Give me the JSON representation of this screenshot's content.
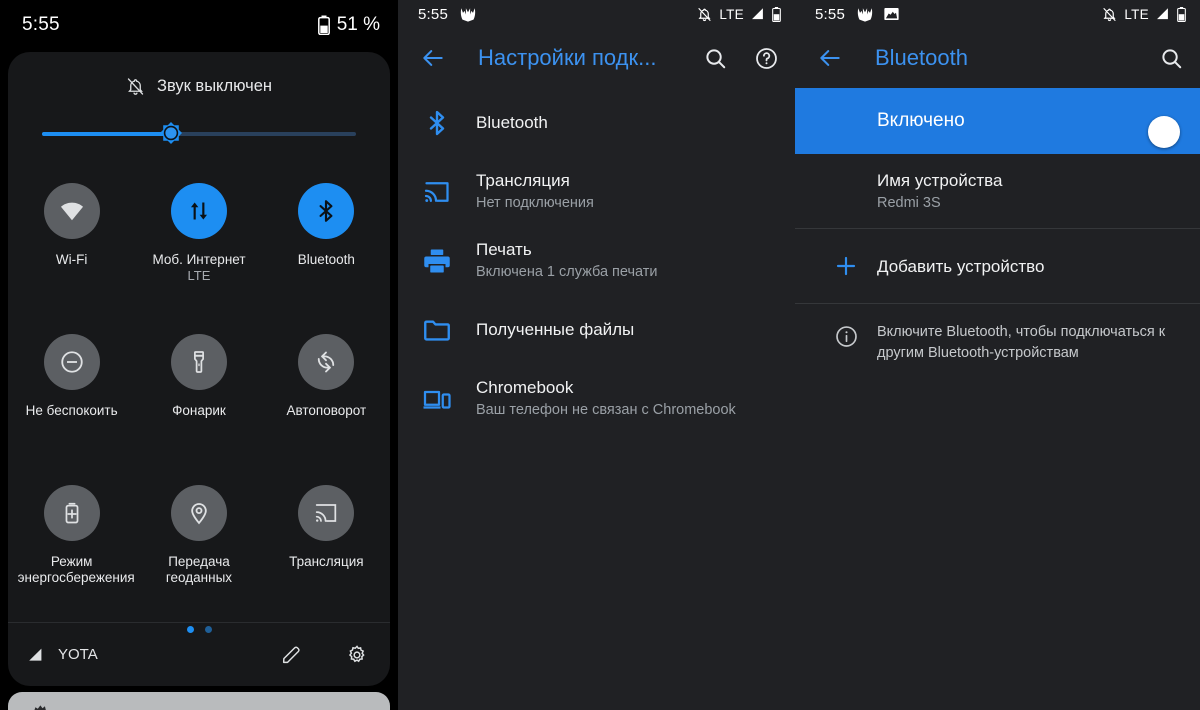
{
  "quick_settings": {
    "status_bar": {
      "clock": "5:55",
      "battery_percent": "51 %",
      "battery_icon": "battery-icon"
    },
    "sound": {
      "label": "Звук выключен",
      "icon": "bell-muted-icon"
    },
    "brightness_slider": {
      "name": "brightness-slider",
      "value_percent": 41,
      "thumb_icon": "brightness-sun-icon"
    },
    "tiles": [
      {
        "label": "Wi-Fi",
        "sub": "",
        "icon": "wifi-icon",
        "active": false
      },
      {
        "label": "Моб. Интернет",
        "sub": "LTE",
        "icon": "mobile-data-icon",
        "active": true
      },
      {
        "label": "Bluetooth",
        "sub": "",
        "icon": "bluetooth-icon",
        "active": true
      },
      {
        "label": "Не беспокоить",
        "sub": "",
        "icon": "do-not-disturb-icon",
        "active": false
      },
      {
        "label": "Фонарик",
        "sub": "",
        "icon": "flashlight-icon",
        "active": false
      },
      {
        "label": "Автоповорот",
        "sub": "",
        "icon": "auto-rotate-icon",
        "active": false
      },
      {
        "label": "Режим энергосбережения",
        "sub": "",
        "icon": "battery-saver-icon",
        "active": false
      },
      {
        "label": "Передача геоданных",
        "sub": "",
        "icon": "location-pin-icon",
        "active": false
      },
      {
        "label": "Трансляция",
        "sub": "",
        "icon": "cast-icon",
        "active": false
      }
    ],
    "page_dots": {
      "count": 2,
      "active_index": 0
    },
    "footer": {
      "signal_icon": "signal-bars-icon",
      "carrier": "YOTA",
      "edit_icon": "pencil-icon",
      "settings_icon": "gear-icon"
    },
    "accent_color": "#1d8ef2",
    "card_color": "#17181a"
  },
  "connection_settings": {
    "status_bar": {
      "clock": "5:55",
      "left_icons": [
        "app-icon"
      ],
      "right_icons": [
        "bell-muted-icon",
        "signal-bars-icon",
        "battery-icon"
      ],
      "network_label": "LTE"
    },
    "app_bar": {
      "back_icon": "back-arrow-icon",
      "title": "Настройки подк...",
      "search_icon": "search-icon",
      "help_icon": "help-circle-icon"
    },
    "items": [
      {
        "icon": "bluetooth-icon",
        "title": "Bluetooth",
        "sub": ""
      },
      {
        "icon": "cast-icon",
        "title": "Трансляция",
        "sub": "Нет подключения"
      },
      {
        "icon": "printer-icon",
        "title": "Печать",
        "sub": "Включена 1 служба печати"
      },
      {
        "icon": "folder-icon",
        "title": "Полученные файлы",
        "sub": ""
      },
      {
        "icon": "chromebook-icon",
        "title": "Chromebook",
        "sub": "Ваш телефон не связан с Chromebook"
      }
    ],
    "accent_color": "#3c92f0",
    "background": "#202124"
  },
  "bluetooth": {
    "status_bar": {
      "clock": "5:55",
      "left_icons": [
        "app-icon",
        "image-icon"
      ],
      "right_icons": [
        "bell-muted-icon",
        "signal-bars-icon",
        "battery-icon"
      ],
      "network_label": "LTE"
    },
    "app_bar": {
      "back_icon": "back-arrow-icon",
      "title": "Bluetooth",
      "search_icon": "search-icon"
    },
    "toggle_banner": {
      "label": "Включено",
      "state": "on",
      "banner_color": "#1f7ae0"
    },
    "device_name": {
      "title": "Имя устройства",
      "value": "Redmi 3S"
    },
    "add_device": {
      "icon": "plus-icon",
      "label": "Добавить устройство"
    },
    "hint": {
      "icon": "info-icon",
      "text": "Включите Bluetooth, чтобы подключаться к другим Bluetooth-устройствам"
    },
    "accent_color": "#3c92f0"
  }
}
